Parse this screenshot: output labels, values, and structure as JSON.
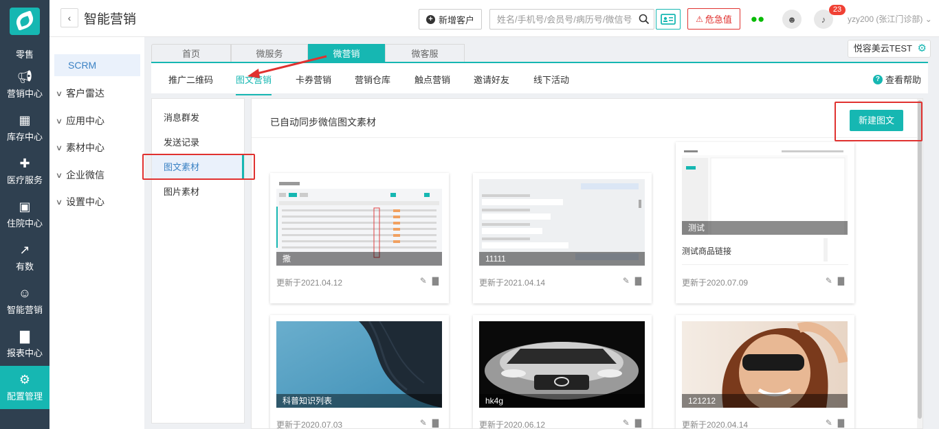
{
  "leftnav": {
    "items": [
      {
        "label": "零售",
        "icon": "retail-icon"
      },
      {
        "label": "营销中心",
        "icon": "megaphone-icon"
      },
      {
        "label": "库存中心",
        "icon": "grid-icon"
      },
      {
        "label": "医疗服务",
        "icon": "medical-kit-icon"
      },
      {
        "label": "住院中心",
        "icon": "building-icon"
      },
      {
        "label": "有数",
        "icon": "trend-icon"
      },
      {
        "label": "智能营销",
        "icon": "smart-marketing-icon"
      },
      {
        "label": "报表中心",
        "icon": "bar-chart-icon"
      },
      {
        "label": "配置管理",
        "icon": "gear-icon"
      }
    ]
  },
  "header": {
    "title": "智能营销",
    "new_customer": "新增客户",
    "search_placeholder": "姓名/手机号/会员号/病历号/微信号",
    "danger_label": "危急值",
    "badge_count": "23",
    "user": "yzy200 (张江门诊部)"
  },
  "subnav": {
    "scrm": "SCRM",
    "items": [
      "客户雷达",
      "应用中心",
      "素材中心",
      "企业微信",
      "设置中心"
    ]
  },
  "tabs": [
    "首页",
    "微服务",
    "微营销",
    "微客服"
  ],
  "tenant_tag": "悦容美云TEST",
  "subtabs": [
    "推广二维码",
    "图文营销",
    "卡券营销",
    "营销仓库",
    "触点营销",
    "邀请好友",
    "线下活动"
  ],
  "help_label": "查看帮助",
  "leftmenu": [
    "消息群发",
    "发送记录",
    "图文素材",
    "图片素材"
  ],
  "content": {
    "heading": "已自动同步微信图文素材",
    "new_button": "新建图文",
    "cards": [
      {
        "caption": "撒",
        "date": "更新于2021.04.12"
      },
      {
        "caption": "11111",
        "date": "更新于2021.04.14"
      },
      {
        "caption": "测试",
        "subtitle": "测试商品链接",
        "date": "更新于2020.07.09"
      },
      {
        "caption": "科普知识列表",
        "date": "更新于2020.07.03"
      },
      {
        "caption": "hk4g",
        "date": "更新于2020.06.12"
      },
      {
        "caption": "121212",
        "date": "更新于2020.04.14"
      }
    ]
  },
  "colors": {
    "accent": "#16b7b2",
    "nav_bg": "#2f4050",
    "danger": "#e0312f"
  }
}
